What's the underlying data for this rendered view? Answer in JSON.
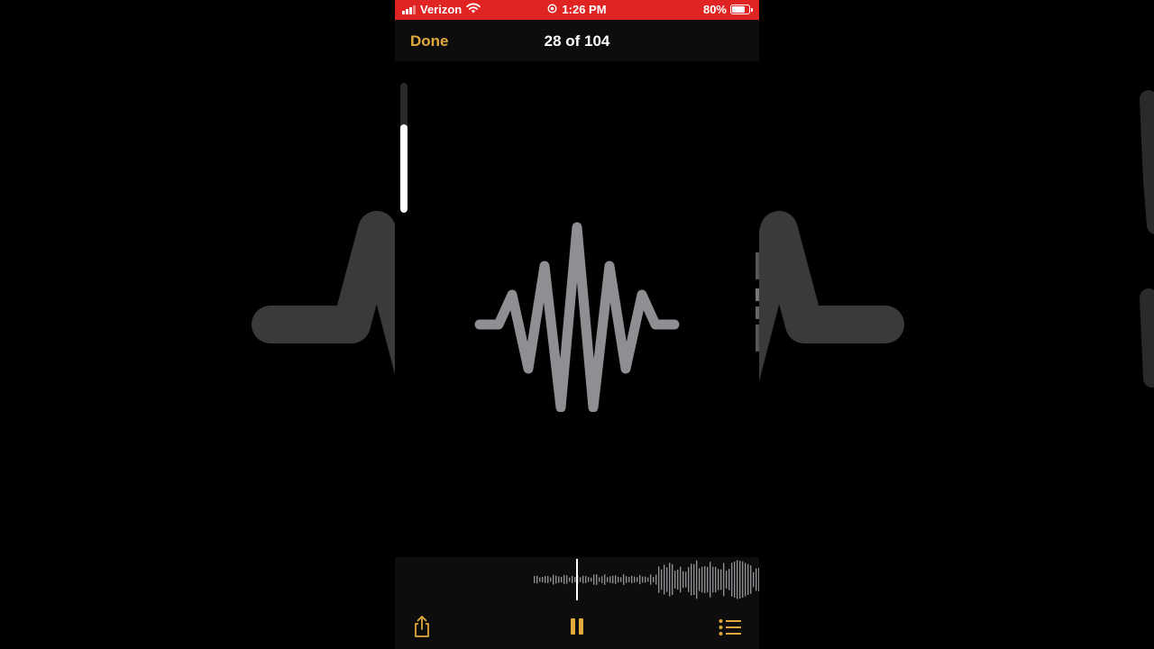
{
  "status_bar": {
    "carrier": "Verizon",
    "time": "1:26 PM",
    "battery_percent": "80%",
    "battery_level": 0.8,
    "status_color": "#e02424"
  },
  "nav": {
    "done_label": "Done",
    "title": "28 of 104"
  },
  "volume_level": 0.68,
  "icons": {
    "wifi": "wifi-icon",
    "location": "location-icon",
    "battery": "battery-icon",
    "share": "share-icon",
    "pause": "pause-icon",
    "list": "list-icon",
    "waveform": "waveform-icon"
  },
  "colors": {
    "accent": "#e2a93b",
    "waveform": "#8e8e93",
    "background": "#000000"
  }
}
